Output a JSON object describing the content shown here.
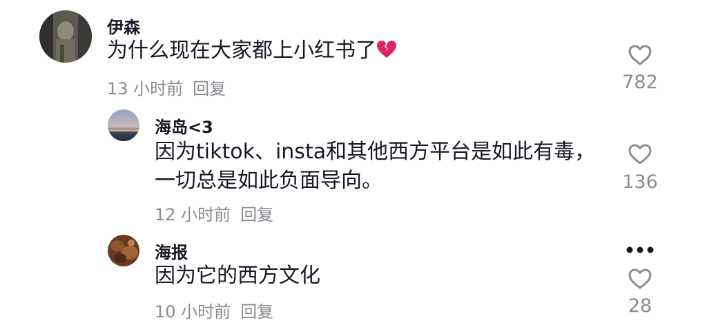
{
  "comments": [
    {
      "username": "伊森",
      "text": "为什么现在大家都上小红书了",
      "emoji": "broken-heart-icon",
      "time": "13 小时前",
      "reply_label": "回复",
      "likes": "782"
    },
    {
      "username": "海岛<3",
      "text_line1": "因为tiktok、insta和其他西方平台是如此有毒，",
      "text_line2": "一切总是如此负面导向。",
      "time": "12 小时前",
      "reply_label": "回复",
      "likes": "136"
    },
    {
      "username": "海报",
      "text": "因为它的西方文化",
      "time": "10 小时前",
      "reply_label": "回复",
      "likes": "28",
      "more_icon": "more-dots-icon"
    }
  ],
  "colors": {
    "text_primary": "#161823",
    "text_secondary": "#8a8b91",
    "broken_heart": "#e0245e"
  }
}
